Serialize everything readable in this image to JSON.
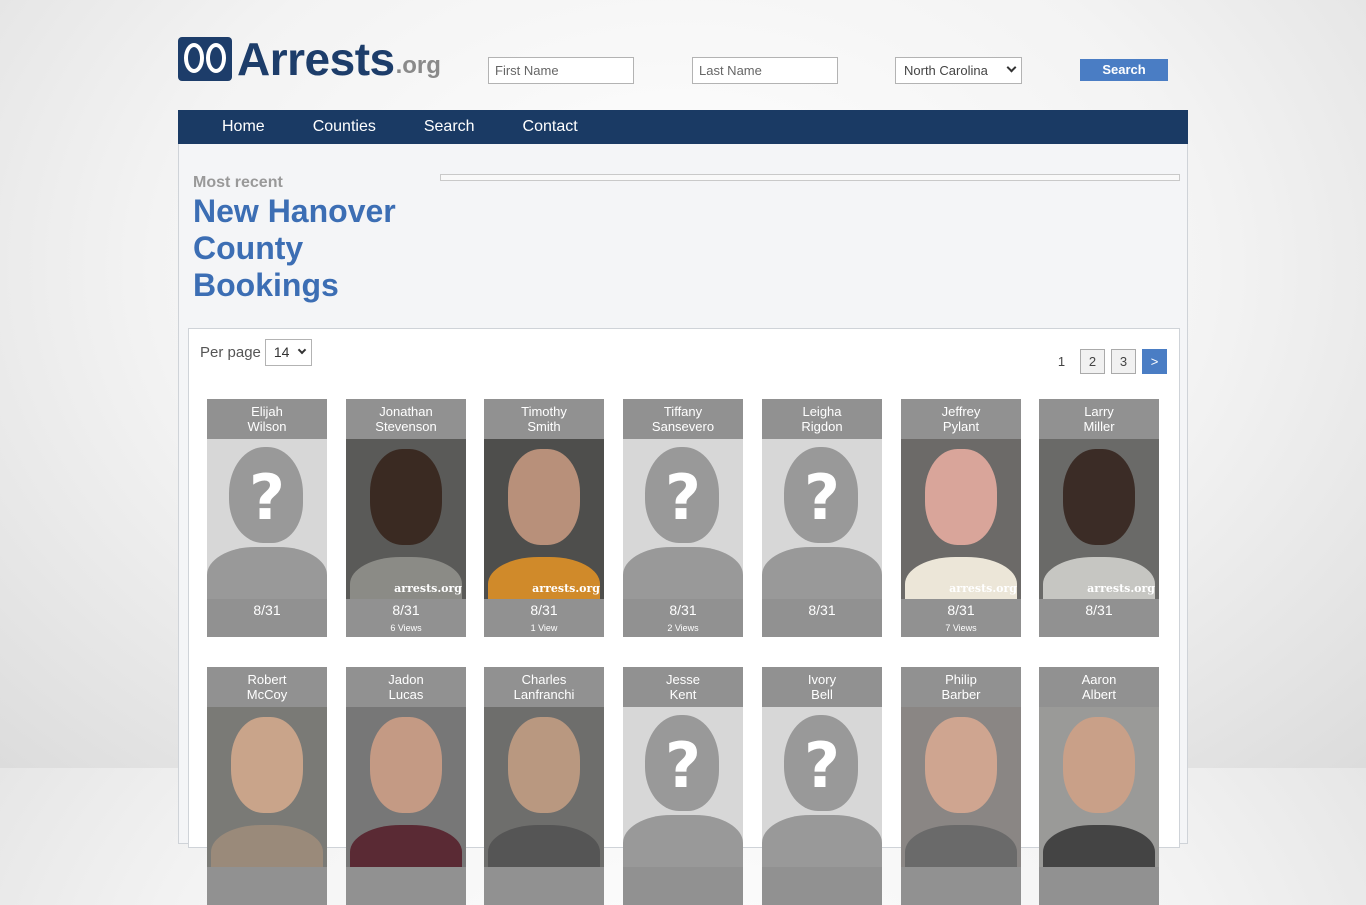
{
  "brand": {
    "name": "Arrests",
    "suffix": ".org"
  },
  "search": {
    "first_name_placeholder": "First Name",
    "last_name_placeholder": "Last Name",
    "state_selected": "North Carolina",
    "button_label": "Search"
  },
  "nav": {
    "items": [
      "Home",
      "Counties",
      "Search",
      "Contact"
    ]
  },
  "page": {
    "label": "Most recent",
    "title": "New Hanover County Bookings"
  },
  "listing": {
    "per_page_label": "Per page",
    "per_page_value": "14",
    "pages": [
      "1",
      "2",
      "3",
      ">"
    ]
  },
  "cards": [
    {
      "first": "Elijah",
      "last": "Wilson",
      "date": "8/31",
      "views": "",
      "photo": "placeholder"
    },
    {
      "first": "Jonathan",
      "last": "Stevenson",
      "date": "8/31",
      "views": "6 Views",
      "photo": "mugshot",
      "skin": "#3a2a22",
      "bg": "#5a5a58",
      "shirt": "#8b8b86",
      "watermark": "arrests.org"
    },
    {
      "first": "Timothy",
      "last": "Smith",
      "date": "8/31",
      "views": "1 View",
      "photo": "mugshot",
      "skin": "#b8907a",
      "bg": "#4e4e4c",
      "shirt": "#d08a2a",
      "watermark": "arrests.org"
    },
    {
      "first": "Tiffany",
      "last": "Sansevero",
      "date": "8/31",
      "views": "2 Views",
      "photo": "placeholder"
    },
    {
      "first": "Leigha",
      "last": "Rigdon",
      "date": "8/31",
      "views": "",
      "photo": "placeholder"
    },
    {
      "first": "Jeffrey",
      "last": "Pylant",
      "date": "8/31",
      "views": "7 Views",
      "photo": "mugshot",
      "skin": "#d9a59a",
      "bg": "#6c6a68",
      "shirt": "#ece6d8",
      "watermark": "arrests.org"
    },
    {
      "first": "Larry",
      "last": "Miller",
      "date": "8/31",
      "views": "",
      "photo": "mugshot",
      "skin": "#3b2c26",
      "bg": "#6a6a68",
      "shirt": "#c6c6c2",
      "watermark": "arrests.org"
    },
    {
      "first": "Robert",
      "last": "McCoy",
      "date": "",
      "views": "",
      "photo": "mugshot",
      "skin": "#c9a48a",
      "bg": "#7a7a76",
      "shirt": "#9a8a7a",
      "watermark": ""
    },
    {
      "first": "Jadon",
      "last": "Lucas",
      "date": "",
      "views": "",
      "photo": "mugshot",
      "skin": "#c49a84",
      "bg": "#777",
      "shirt": "#5a2a34",
      "watermark": ""
    },
    {
      "first": "Charles",
      "last": "Lanfranchi",
      "date": "",
      "views": "",
      "photo": "mugshot",
      "skin": "#b99880",
      "bg": "#6e6e6c",
      "shirt": "#555",
      "watermark": ""
    },
    {
      "first": "Jesse",
      "last": "Kent",
      "date": "",
      "views": "",
      "photo": "placeholder"
    },
    {
      "first": "Ivory",
      "last": "Bell",
      "date": "",
      "views": "",
      "photo": "placeholder"
    },
    {
      "first": "Philip",
      "last": "Barber",
      "date": "",
      "views": "",
      "photo": "mugshot",
      "skin": "#cfa590",
      "bg": "#8a8684",
      "shirt": "#6a6a6a",
      "watermark": ""
    },
    {
      "first": "Aaron",
      "last": "Albert",
      "date": "",
      "views": "",
      "photo": "mugshot",
      "skin": "#c9a088",
      "bg": "#9a9a98",
      "shirt": "#444",
      "watermark": ""
    }
  ]
}
